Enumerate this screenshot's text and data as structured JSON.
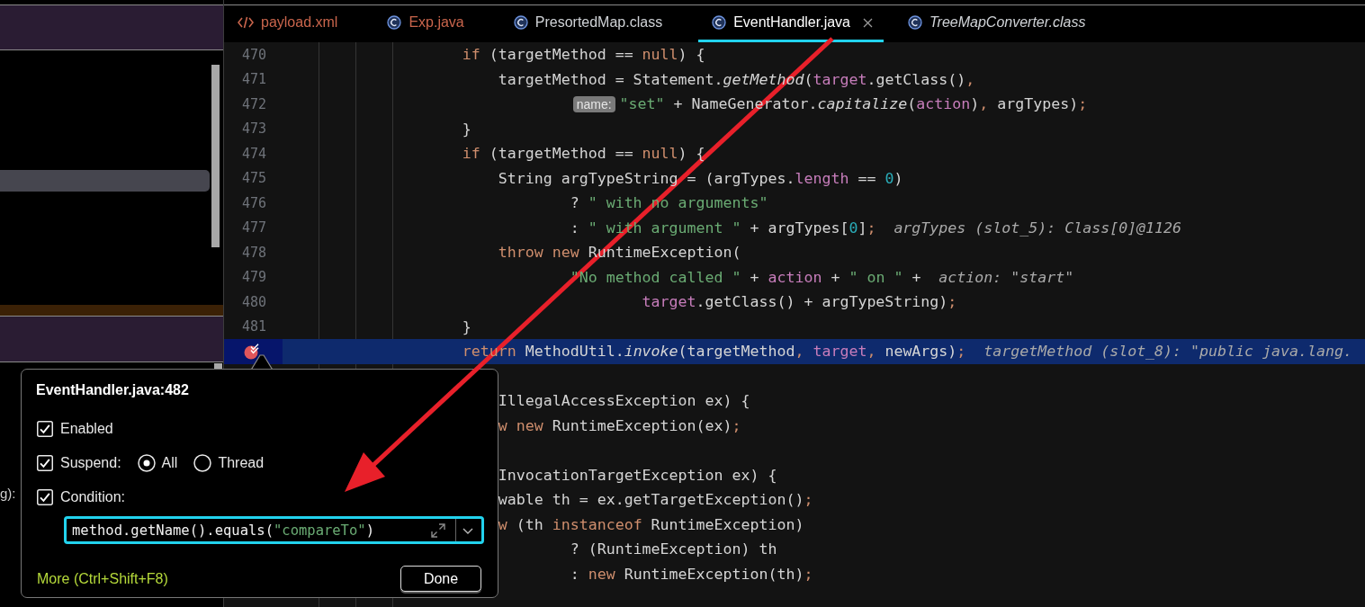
{
  "sidebar": {
    "fragment_text": "g):"
  },
  "tabs": [
    {
      "label": "payload.xml",
      "kind": "xml",
      "color": "#c9654c",
      "selected": false,
      "preview": false
    },
    {
      "label": "Exp.java",
      "kind": "class",
      "color": "#c9654c",
      "selected": false,
      "preview": false
    },
    {
      "label": "PresortedMap.class",
      "kind": "class",
      "color": "#cfd2d6",
      "selected": false,
      "preview": false
    },
    {
      "label": "EventHandler.java",
      "kind": "class",
      "color": "#ffffff",
      "selected": true,
      "preview": false
    },
    {
      "label": "TreeMapConverter.class",
      "kind": "class",
      "color": "#cfd2d6",
      "selected": false,
      "preview": true
    }
  ],
  "editor": {
    "lines": [
      {
        "number": "470",
        "breakpoint": false,
        "kind": "block",
        "code": [
          {
            "kind": "keyword",
            "text": "if"
          },
          {
            "kind": "plain",
            "text": " (targetMethod == "
          },
          {
            "kind": "keyword",
            "text": "null"
          },
          {
            "kind": "plain",
            "text": ") {"
          }
        ]
      },
      {
        "number": "471",
        "breakpoint": false,
        "kind": "statement",
        "code": [
          {
            "kind": "plain",
            "text": "targetMethod = Statement."
          },
          {
            "kind": "static",
            "text": "getMethod"
          },
          {
            "kind": "plain",
            "text": "("
          },
          {
            "kind": "field",
            "text": "target"
          },
          {
            "kind": "plain",
            "text": ".getClass()"
          },
          {
            "kind": "punct",
            "text": ","
          }
        ]
      },
      {
        "number": "472",
        "breakpoint": false,
        "kind": "continuation",
        "param_hint": "name:",
        "code": [
          {
            "kind": "string",
            "text": "\"set\""
          },
          {
            "kind": "plain",
            "text": " + NameGenerator."
          },
          {
            "kind": "static",
            "text": "capitalize"
          },
          {
            "kind": "plain",
            "text": "("
          },
          {
            "kind": "field",
            "text": "action"
          },
          {
            "kind": "plain",
            "text": ")"
          },
          {
            "kind": "punct",
            "text": ","
          },
          {
            "kind": "plain",
            "text": " argTypes)"
          },
          {
            "kind": "punct",
            "text": ";"
          }
        ]
      },
      {
        "number": "473",
        "breakpoint": false,
        "kind": "block",
        "code": [
          {
            "kind": "plain",
            "text": "}"
          }
        ]
      },
      {
        "number": "474",
        "breakpoint": false,
        "kind": "block",
        "code": [
          {
            "kind": "keyword",
            "text": "if"
          },
          {
            "kind": "plain",
            "text": " (targetMethod == "
          },
          {
            "kind": "keyword",
            "text": "null"
          },
          {
            "kind": "plain",
            "text": ") {"
          }
        ]
      },
      {
        "number": "475",
        "breakpoint": false,
        "kind": "statement",
        "code": [
          {
            "kind": "plain",
            "text": "String argTypeString = (argTypes."
          },
          {
            "kind": "field",
            "text": "length"
          },
          {
            "kind": "plain",
            "text": " == "
          },
          {
            "kind": "number",
            "text": "0"
          },
          {
            "kind": "plain",
            "text": ")"
          }
        ]
      },
      {
        "number": "476",
        "breakpoint": false,
        "kind": "continuation",
        "code": [
          {
            "kind": "plain",
            "text": "? "
          },
          {
            "kind": "string",
            "text": "\" with no arguments\""
          }
        ]
      },
      {
        "number": "477",
        "breakpoint": false,
        "kind": "continuation",
        "code": [
          {
            "kind": "plain",
            "text": ": "
          },
          {
            "kind": "string",
            "text": "\" with argument \""
          },
          {
            "kind": "plain",
            "text": " + argTypes["
          },
          {
            "kind": "number",
            "text": "0"
          },
          {
            "kind": "plain",
            "text": "]"
          },
          {
            "kind": "punct",
            "text": ";"
          }
        ],
        "inline_value": "argTypes (slot_5): Class[0]@1126"
      },
      {
        "number": "478",
        "breakpoint": false,
        "kind": "statement",
        "code": [
          {
            "kind": "keyword",
            "text": "throw new"
          },
          {
            "kind": "plain",
            "text": " RuntimeException("
          }
        ]
      },
      {
        "number": "479",
        "breakpoint": false,
        "kind": "continuation",
        "code": [
          {
            "kind": "string",
            "text": "\"No method called \""
          },
          {
            "kind": "plain",
            "text": " + "
          },
          {
            "kind": "field",
            "text": "action"
          },
          {
            "kind": "plain",
            "text": " + "
          },
          {
            "kind": "string",
            "text": "\" on \""
          },
          {
            "kind": "plain",
            "text": " +"
          }
        ],
        "inline_value": "action: \"start\""
      },
      {
        "number": "480",
        "breakpoint": false,
        "kind": "argument",
        "code": [
          {
            "kind": "field",
            "text": "target"
          },
          {
            "kind": "plain",
            "text": ".getClass() + argTypeString)"
          },
          {
            "kind": "punct",
            "text": ";"
          }
        ]
      },
      {
        "number": "481",
        "breakpoint": false,
        "kind": "block",
        "code": [
          {
            "kind": "plain",
            "text": "}"
          }
        ]
      },
      {
        "breakpoint": true,
        "kind": "block",
        "code": [
          {
            "kind": "keyword",
            "text": "return"
          },
          {
            "kind": "plain",
            "text": " MethodUtil."
          },
          {
            "kind": "static",
            "text": "invoke"
          },
          {
            "kind": "plain",
            "text": "(targetMethod"
          },
          {
            "kind": "punct",
            "text": ", "
          },
          {
            "kind": "field",
            "text": "target"
          },
          {
            "kind": "punct",
            "text": ","
          },
          {
            "kind": "plain",
            "text": " newArgs)"
          },
          {
            "kind": "punct",
            "text": ";"
          }
        ],
        "inline_value": "targetMethod (slot_8): \"public java.lang."
      },
      {
        "breakpoint": false
      },
      {
        "breakpoint": false,
        "kind": "statement",
        "code": [
          {
            "kind": "plain",
            "text": "IllegalAccessException ex) {"
          }
        ]
      },
      {
        "breakpoint": false,
        "kind": "statement",
        "code": [
          {
            "kind": "keyword",
            "text": "w new"
          },
          {
            "kind": "plain",
            "text": " RuntimeException(ex)"
          },
          {
            "kind": "punct",
            "text": ";"
          }
        ]
      },
      {
        "breakpoint": false
      },
      {
        "breakpoint": false,
        "kind": "statement",
        "code": [
          {
            "kind": "plain",
            "text": "InvocationTargetException ex) {"
          }
        ]
      },
      {
        "breakpoint": false,
        "kind": "statement",
        "code": [
          {
            "kind": "plain",
            "text": "wable th = ex.getTargetException()"
          },
          {
            "kind": "punct",
            "text": ";"
          }
        ]
      },
      {
        "breakpoint": false,
        "kind": "statement",
        "code": [
          {
            "kind": "keyword",
            "text": "w"
          },
          {
            "kind": "plain",
            "text": " (th "
          },
          {
            "kind": "keyword",
            "text": "instanceof"
          },
          {
            "kind": "plain",
            "text": " RuntimeException)"
          }
        ]
      },
      {
        "breakpoint": false,
        "kind": "continuation",
        "code": [
          {
            "kind": "plain",
            "text": "? (RuntimeException) th"
          }
        ]
      },
      {
        "breakpoint": false,
        "kind": "continuation",
        "code": [
          {
            "kind": "plain",
            "text": ": "
          },
          {
            "kind": "keyword",
            "text": "new"
          },
          {
            "kind": "plain",
            "text": " RuntimeException(th)"
          },
          {
            "kind": "punct",
            "text": ";"
          }
        ]
      }
    ]
  },
  "breakpoint_popup": {
    "title": "EventHandler.java:482",
    "enabled": {
      "label": "Enabled",
      "checked": true
    },
    "suspend": {
      "label": "Suspend:",
      "checked": true,
      "options": [
        {
          "label": "All",
          "selected": true
        },
        {
          "label": "Thread",
          "selected": false
        }
      ]
    },
    "condition": {
      "label": "Condition:",
      "checked": true,
      "value": [
        {
          "kind": "plain",
          "text": "method.getName().equals("
        },
        {
          "kind": "string",
          "text": "\"compareTo\""
        },
        {
          "kind": "plain",
          "text": ")"
        }
      ]
    },
    "more_link": "More (Ctrl+Shift+F8)",
    "done_button": "Done"
  }
}
